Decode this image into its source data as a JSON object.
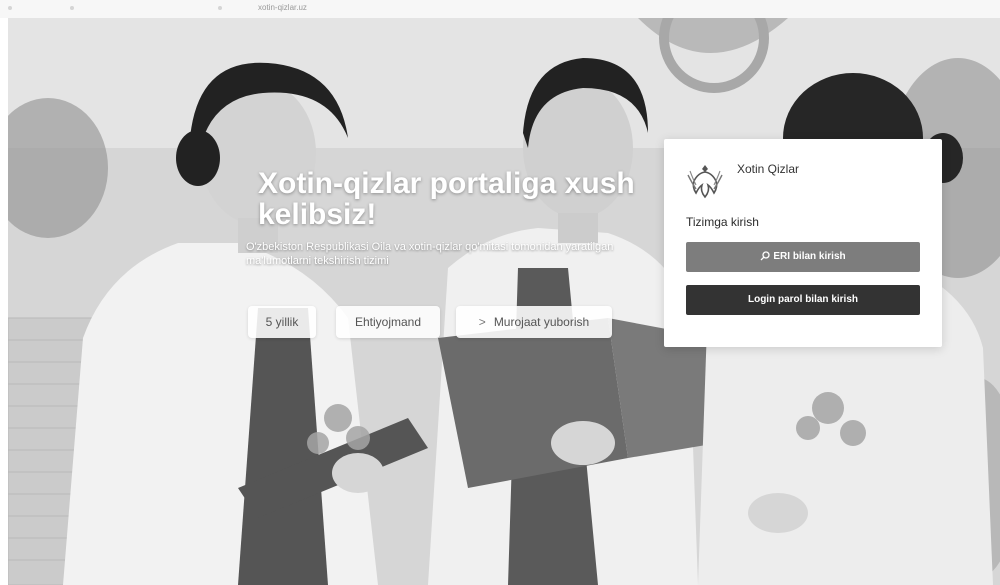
{
  "browser": {
    "url": "xotin-qizlar.uz"
  },
  "hero": {
    "title": "Xotin-qizlar portaliga xush kelibsiz!",
    "description": "O'zbekiston Respublikasi Oila va xotin-qizlar qo'mitasi tomonidan yaratilgan ma'lumotlarni tekshirish tizimi",
    "actions": [
      {
        "label": "5 yillik"
      },
      {
        "label": "Ehtiyojmand"
      },
      {
        "label": "Murojaat yuborish",
        "icon": "arrow-right-icon"
      }
    ]
  },
  "login": {
    "brand": "Xotin Qizlar",
    "logo_icon": "emblem-icon",
    "title": "Tizimga kirish",
    "eri_button": "ERI bilan kirish",
    "eri_icon": "search-icon",
    "password_button": "Login parol bilan kirish"
  },
  "colors": {
    "eri_button": "#7d7d7d",
    "login_button": "#333333",
    "card": "#ffffff"
  }
}
